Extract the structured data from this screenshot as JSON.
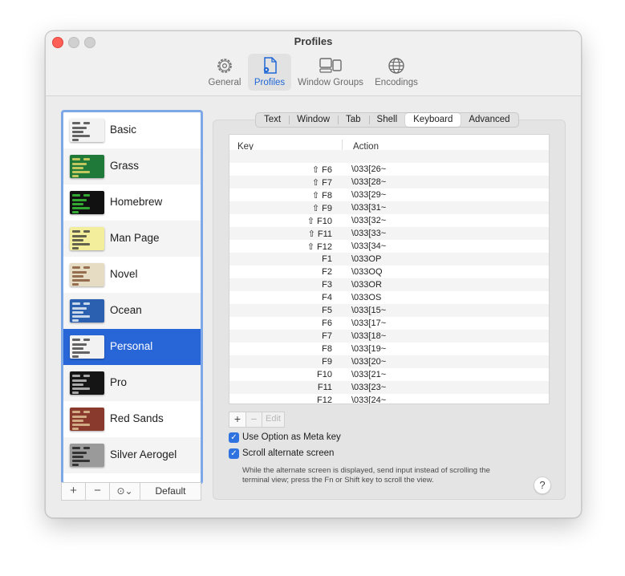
{
  "window": {
    "title": "Profiles"
  },
  "toolbar": {
    "items": [
      {
        "label": "General",
        "icon": "gear-icon",
        "selected": false
      },
      {
        "label": "Profiles",
        "icon": "profiles-icon",
        "selected": true
      },
      {
        "label": "Window Groups",
        "icon": "window-groups-icon",
        "selected": false
      },
      {
        "label": "Encodings",
        "icon": "globe-icon",
        "selected": false
      }
    ]
  },
  "profiles": {
    "items": [
      {
        "name": "Basic",
        "thumb_bg": "#f2f2f2",
        "thumb_fg": "#333333",
        "selected": false
      },
      {
        "name": "Grass",
        "thumb_bg": "#1f7a3a",
        "thumb_fg": "#f5e26b",
        "selected": false
      },
      {
        "name": "Homebrew",
        "thumb_bg": "#111111",
        "thumb_fg": "#3ddb3d",
        "selected": false
      },
      {
        "name": "Man Page",
        "thumb_bg": "#f3ee9c",
        "thumb_fg": "#333333",
        "selected": false
      },
      {
        "name": "Novel",
        "thumb_bg": "#e6dcc4",
        "thumb_fg": "#7a4a2a",
        "selected": false
      },
      {
        "name": "Ocean",
        "thumb_bg": "#2b5fb0",
        "thumb_fg": "#ffffff",
        "selected": false
      },
      {
        "name": "Personal",
        "thumb_bg": "#f2f2f2",
        "thumb_fg": "#333333",
        "selected": true
      },
      {
        "name": "Pro",
        "thumb_bg": "#151515",
        "thumb_fg": "#d8d8d8",
        "selected": false
      },
      {
        "name": "Red Sands",
        "thumb_bg": "#8a3a2c",
        "thumb_fg": "#e8d2a0",
        "selected": false
      },
      {
        "name": "Silver Aerogel",
        "thumb_bg": "#9a9a9a",
        "thumb_fg": "#111111",
        "selected": false
      }
    ],
    "controls": {
      "add": "+",
      "remove": "−",
      "more": "⊙⌄",
      "default": "Default"
    }
  },
  "tabs": {
    "items": [
      "Text",
      "Window",
      "Tab",
      "Shell",
      "Keyboard",
      "Advanced"
    ],
    "selected": "Keyboard"
  },
  "keyboard": {
    "columns": {
      "key": "Key",
      "action": "Action"
    },
    "rows": [
      {
        "key": "⇧ F6",
        "action": "\\033[26~"
      },
      {
        "key": "⇧ F7",
        "action": "\\033[28~"
      },
      {
        "key": "⇧ F8",
        "action": "\\033[29~"
      },
      {
        "key": "⇧ F9",
        "action": "\\033[31~"
      },
      {
        "key": "⇧ F10",
        "action": "\\033[32~"
      },
      {
        "key": "⇧ F11",
        "action": "\\033[33~"
      },
      {
        "key": "⇧ F12",
        "action": "\\033[34~"
      },
      {
        "key": "F1",
        "action": "\\033OP"
      },
      {
        "key": "F2",
        "action": "\\033OQ"
      },
      {
        "key": "F3",
        "action": "\\033OR"
      },
      {
        "key": "F4",
        "action": "\\033OS"
      },
      {
        "key": "F5",
        "action": "\\033[15~"
      },
      {
        "key": "F6",
        "action": "\\033[17~"
      },
      {
        "key": "F7",
        "action": "\\033[18~"
      },
      {
        "key": "F8",
        "action": "\\033[19~"
      },
      {
        "key": "F9",
        "action": "\\033[20~"
      },
      {
        "key": "F10",
        "action": "\\033[21~"
      },
      {
        "key": "F11",
        "action": "\\033[23~"
      },
      {
        "key": "F12",
        "action": "\\033[24~"
      }
    ],
    "controls": {
      "add": "+",
      "remove": "−",
      "edit": "Edit"
    },
    "option_as_meta": {
      "label": "Use Option as Meta key",
      "checked": true
    },
    "scroll_alternate": {
      "label": "Scroll alternate screen",
      "checked": true
    },
    "help_text": "While the alternate screen is displayed, send input instead of scrolling the terminal view; press the Fn or Shift key to scroll the view.",
    "help_button": "?"
  },
  "colors": {
    "accent": "#2866d8",
    "list_focus_ring": "#7ea7e8",
    "checkbox": "#2f73e0"
  }
}
